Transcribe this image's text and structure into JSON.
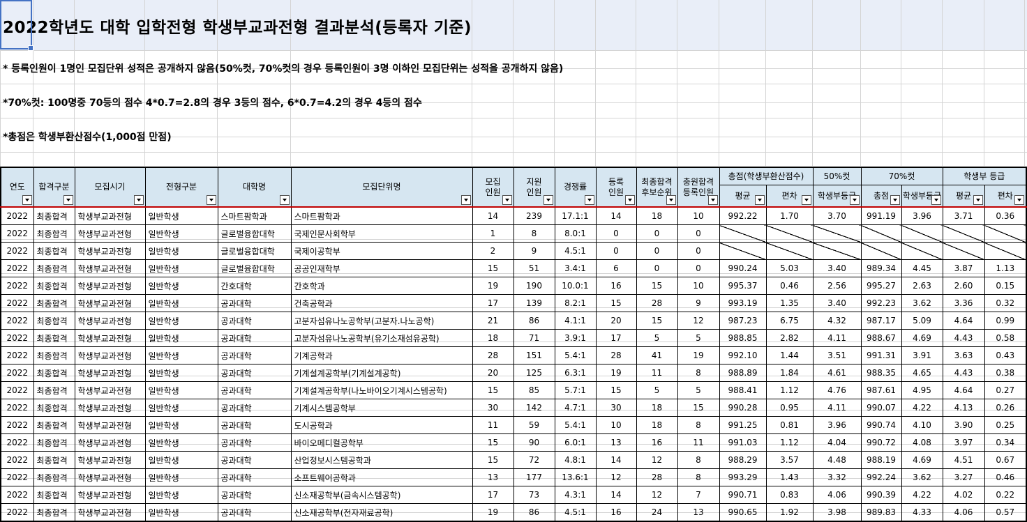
{
  "title": "2022학년도 대학 입학전형 학생부교과전형 결과분석(등록자 기준)",
  "notes": [
    "* 등록인원이 1명인 모집단위 성적은 공개하지 않음(50%컷, 70%컷의 경우 등록인원이 3명 이하인 모집단위는 성적을 공개하지 않음)",
    "*70%컷: 100명중 70등의 점수 4*0.7=2.8의 경우 3등의 점수, 6*0.7=4.2의 경우 4등의 점수",
    "*총점은 학생부환산점수(1,000점 만점)"
  ],
  "headers": {
    "year": "연도",
    "pass_type": "합격구분",
    "period": "모집시기",
    "track": "전형구분",
    "college": "대학명",
    "unit": "모집단위명",
    "quota": "모집\n인원",
    "applicants": "지원\n인원",
    "ratio": "경쟁률",
    "enrolled": "등록\n인원",
    "waitlist": "최종합격\n후보순위",
    "extra": "충원합격\n등록인원",
    "total_group": "총점(학생부환산점수)",
    "total_avg": "평균",
    "total_sd": "편차",
    "cut50_group": "50%컷",
    "cut50_grade": "학생부등급",
    "cut70_group": "70%컷",
    "cut70_total": "총점",
    "cut70_grade": "학생부등급",
    "grade_group": "학생부 등급",
    "grade_avg": "평균",
    "grade_sd": "편차"
  },
  "rows": [
    [
      "2022",
      "최종합격",
      "학생부교과전형",
      "일반학생",
      "스마트팜학과",
      "스마트팜학과",
      "14",
      "239",
      "17.1:1",
      "14",
      "18",
      "10",
      "992.22",
      "1.70",
      "3.70",
      "991.19",
      "3.96",
      "3.71",
      "0.36"
    ],
    [
      "2022",
      "최종합격",
      "학생부교과전형",
      "일반학생",
      "글로벌융합대학",
      "국제인문사회학부",
      "1",
      "8",
      "8.0:1",
      "0",
      "0",
      "0",
      "",
      "",
      "",
      "",
      "",
      "",
      ""
    ],
    [
      "2022",
      "최종합격",
      "학생부교과전형",
      "일반학생",
      "글로벌융합대학",
      "국제이공학부",
      "2",
      "9",
      "4.5:1",
      "0",
      "0",
      "0",
      "",
      "",
      "",
      "",
      "",
      "",
      ""
    ],
    [
      "2022",
      "최종합격",
      "학생부교과전형",
      "일반학생",
      "글로벌융합대학",
      "공공인재학부",
      "15",
      "51",
      "3.4:1",
      "6",
      "0",
      "0",
      "990.24",
      "5.03",
      "3.40",
      "989.34",
      "4.45",
      "3.87",
      "1.13"
    ],
    [
      "2022",
      "최종합격",
      "학생부교과전형",
      "일반학생",
      "간호대학",
      "간호학과",
      "19",
      "190",
      "10.0:1",
      "16",
      "15",
      "10",
      "995.37",
      "0.46",
      "2.56",
      "995.27",
      "2.63",
      "2.60",
      "0.15"
    ],
    [
      "2022",
      "최종합격",
      "학생부교과전형",
      "일반학생",
      "공과대학",
      "건축공학과",
      "17",
      "139",
      "8.2:1",
      "15",
      "28",
      "9",
      "993.19",
      "1.35",
      "3.40",
      "992.23",
      "3.62",
      "3.36",
      "0.32"
    ],
    [
      "2022",
      "최종합격",
      "학생부교과전형",
      "일반학생",
      "공과대학",
      "고분자섬유나노공학부(고분자.나노공학)",
      "21",
      "86",
      "4.1:1",
      "20",
      "15",
      "12",
      "987.23",
      "6.75",
      "4.32",
      "987.17",
      "5.09",
      "4.64",
      "0.99"
    ],
    [
      "2022",
      "최종합격",
      "학생부교과전형",
      "일반학생",
      "공과대학",
      "고분자섬유나노공학부(유기소재섬유공학)",
      "18",
      "71",
      "3.9:1",
      "17",
      "5",
      "5",
      "988.85",
      "2.82",
      "4.11",
      "988.67",
      "4.69",
      "4.43",
      "0.58"
    ],
    [
      "2022",
      "최종합격",
      "학생부교과전형",
      "일반학생",
      "공과대학",
      "기계공학과",
      "28",
      "151",
      "5.4:1",
      "28",
      "41",
      "19",
      "992.10",
      "1.44",
      "3.51",
      "991.31",
      "3.91",
      "3.63",
      "0.43"
    ],
    [
      "2022",
      "최종합격",
      "학생부교과전형",
      "일반학생",
      "공과대학",
      "기계설계공학부(기계설계공학)",
      "20",
      "125",
      "6.3:1",
      "19",
      "11",
      "8",
      "988.89",
      "1.84",
      "4.61",
      "988.35",
      "4.65",
      "4.43",
      "0.38"
    ],
    [
      "2022",
      "최종합격",
      "학생부교과전형",
      "일반학생",
      "공과대학",
      "기계설계공학부(나노바이오기계시스템공학)",
      "15",
      "85",
      "5.7:1",
      "15",
      "5",
      "5",
      "988.41",
      "1.12",
      "4.76",
      "987.61",
      "4.95",
      "4.64",
      "0.27"
    ],
    [
      "2022",
      "최종합격",
      "학생부교과전형",
      "일반학생",
      "공과대학",
      "기계시스템공학부",
      "30",
      "142",
      "4.7:1",
      "30",
      "18",
      "15",
      "990.28",
      "0.95",
      "4.11",
      "990.07",
      "4.22",
      "4.13",
      "0.26"
    ],
    [
      "2022",
      "최종합격",
      "학생부교과전형",
      "일반학생",
      "공과대학",
      "도시공학과",
      "11",
      "59",
      "5.4:1",
      "10",
      "18",
      "8",
      "991.25",
      "0.81",
      "3.96",
      "990.74",
      "4.10",
      "3.90",
      "0.25"
    ],
    [
      "2022",
      "최종합격",
      "학생부교과전형",
      "일반학생",
      "공과대학",
      "바이오메디컬공학부",
      "15",
      "90",
      "6.0:1",
      "13",
      "16",
      "11",
      "991.03",
      "1.12",
      "4.04",
      "990.72",
      "4.08",
      "3.97",
      "0.34"
    ],
    [
      "2022",
      "최종합격",
      "학생부교과전형",
      "일반학생",
      "공과대학",
      "산업정보시스템공학과",
      "15",
      "72",
      "4.8:1",
      "14",
      "12",
      "8",
      "988.29",
      "3.57",
      "4.48",
      "988.19",
      "4.69",
      "4.51",
      "0.67"
    ],
    [
      "2022",
      "최종합격",
      "학생부교과전형",
      "일반학생",
      "공과대학",
      "소프트웨어공학과",
      "13",
      "177",
      "13.6:1",
      "12",
      "28",
      "8",
      "993.29",
      "1.43",
      "3.32",
      "992.24",
      "3.62",
      "3.27",
      "0.46"
    ],
    [
      "2022",
      "최종합격",
      "학생부교과전형",
      "일반학생",
      "공과대학",
      "신소재공학부(금속시스템공학)",
      "17",
      "73",
      "4.3:1",
      "14",
      "12",
      "7",
      "990.71",
      "0.83",
      "4.06",
      "990.39",
      "4.22",
      "4.02",
      "0.22"
    ],
    [
      "2022",
      "최종합격",
      "학생부교과전형",
      "일반학생",
      "공과대학",
      "신소재공학부(전자재료공학)",
      "19",
      "86",
      "4.5:1",
      "16",
      "24",
      "13",
      "990.65",
      "1.92",
      "3.98",
      "989.83",
      "4.33",
      "4.06",
      "0.57"
    ]
  ]
}
